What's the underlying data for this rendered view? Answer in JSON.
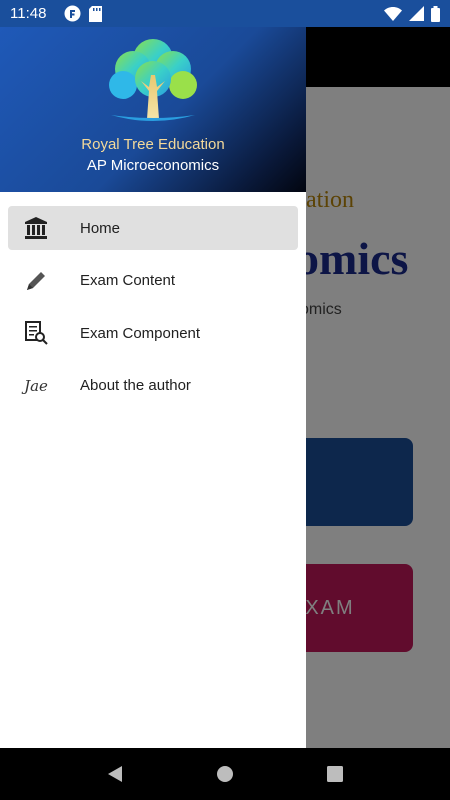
{
  "status_bar": {
    "time": "11:48",
    "icons": [
      "f-app-icon",
      "sd-card-icon",
      "wifi-icon",
      "signal-icon",
      "battery-icon"
    ]
  },
  "background": {
    "line1": "ation",
    "line2": "omics",
    "line3": "omics",
    "button2": "EXAM"
  },
  "drawer": {
    "header": {
      "brand": "Royal Tree Education",
      "course": "AP Microeconomics"
    },
    "items": [
      {
        "label": "Home",
        "icon": "bank-icon",
        "active": true
      },
      {
        "label": "Exam Content",
        "icon": "pencil-icon",
        "active": false
      },
      {
        "label": "Exam Component",
        "icon": "document-search-icon",
        "active": false
      },
      {
        "label": "About the author",
        "icon": "signature-icon",
        "signature": "Jae",
        "active": false
      }
    ]
  },
  "navigation_bar": {
    "buttons": [
      "back-icon",
      "home-icon",
      "recents-icon"
    ]
  },
  "colors": {
    "header_gradient_start": "#1f59b8",
    "header_gradient_end": "#02050f",
    "brand_text": "#f3d99a",
    "active_item_bg": "#e0e0e0",
    "bg_button1": "#1b4e99",
    "bg_button2": "#c2185b"
  }
}
